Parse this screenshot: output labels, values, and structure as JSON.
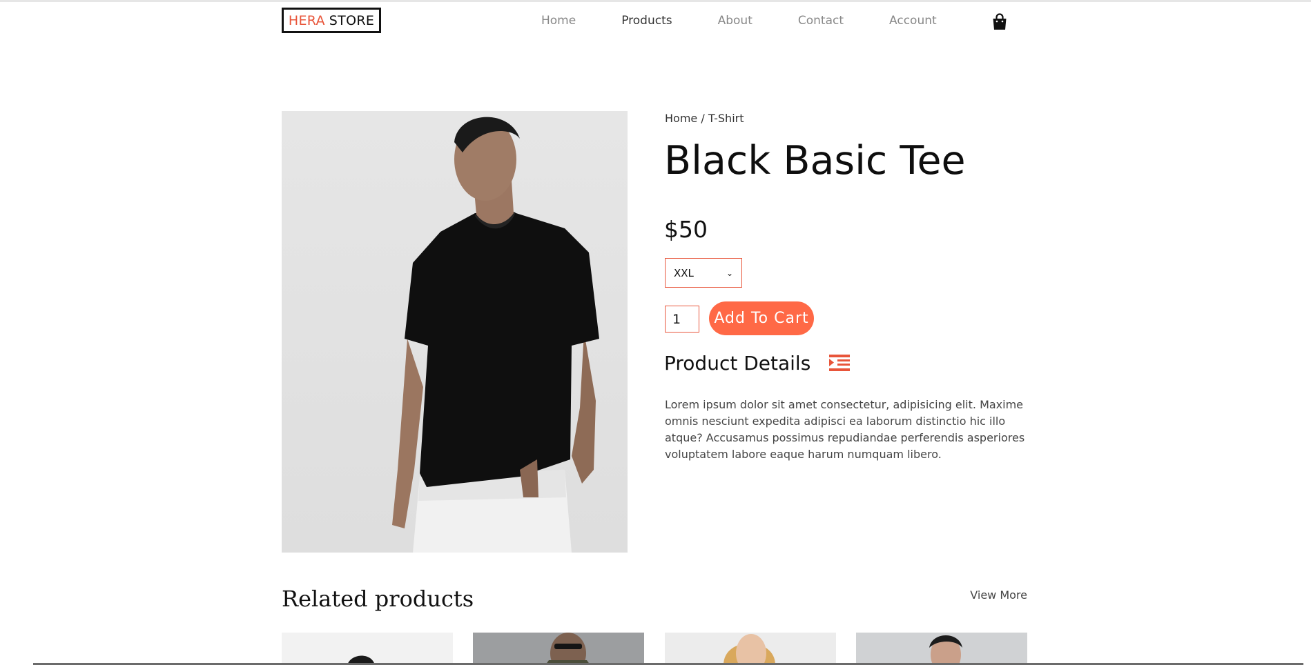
{
  "header": {
    "logo": {
      "part1": "HERA",
      "part2": "STORE"
    },
    "nav": [
      {
        "label": "Home",
        "active": false
      },
      {
        "label": "Products",
        "active": true
      },
      {
        "label": "About",
        "active": false
      },
      {
        "label": "Contact",
        "active": false
      },
      {
        "label": "Account",
        "active": false
      }
    ],
    "cart_icon": "shopping-bag-icon"
  },
  "product": {
    "breadcrumb": {
      "home": "Home",
      "separator": " / ",
      "current": "T-Shirt"
    },
    "title": "Black Basic Tee",
    "price": "$50",
    "size": {
      "selected": "XXL"
    },
    "quantity": "1",
    "add_to_cart_label": "Add To Cart",
    "details_heading": "Product Details",
    "details_icon": "indent-icon",
    "description": "Lorem ipsum dolor sit amet consectetur, adipisicing elit. Maxime omnis nesciunt expedita adipisci ea laborum distinctio hic illo atque? Accusamus possimus repudiandae perferendis asperiores voluptatem labore eaque harum numquam libero."
  },
  "related": {
    "heading": "Related products",
    "view_more": "View More"
  },
  "colors": {
    "accent": "#ff6946",
    "logo_accent": "#e8553a",
    "text": "#111111"
  }
}
